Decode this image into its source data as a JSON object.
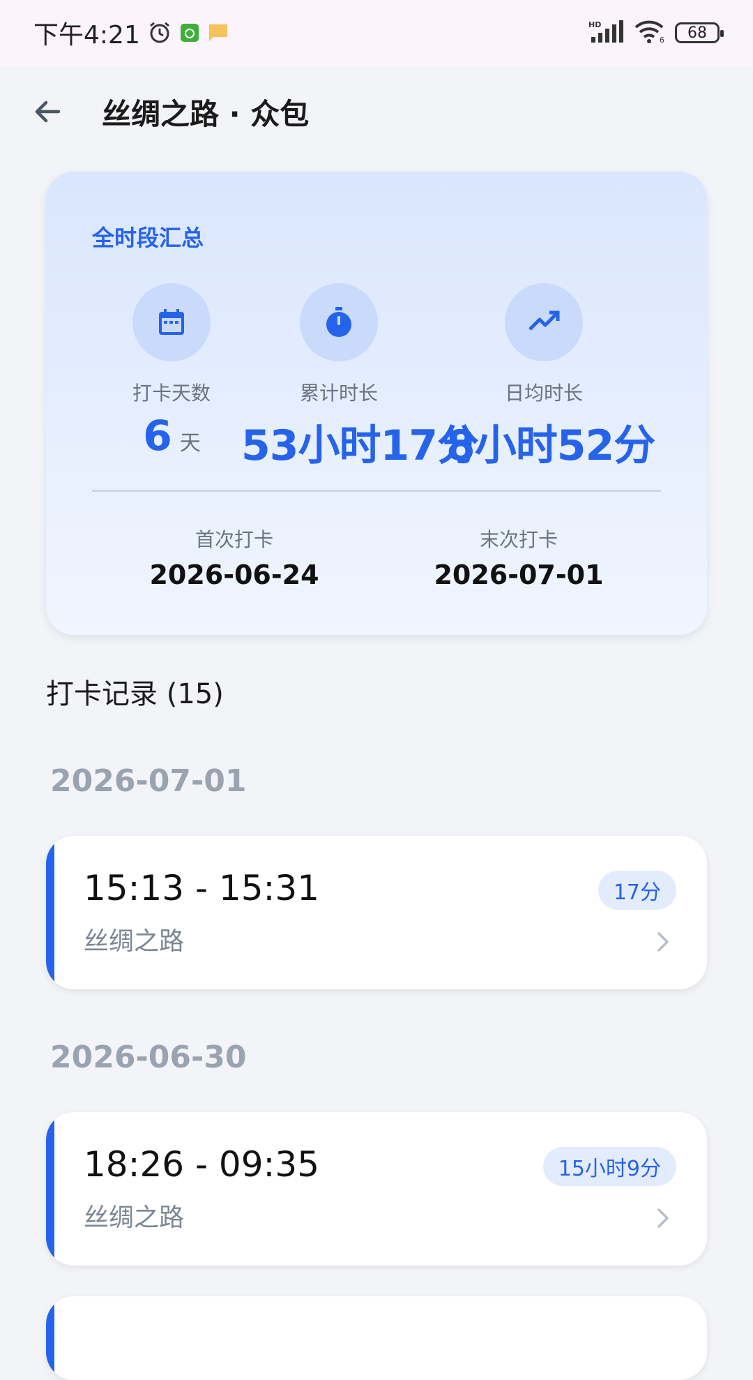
{
  "status_bar": {
    "time": "下午4:21",
    "battery": "68"
  },
  "app_bar": {
    "title": "丝绸之路 · 众包"
  },
  "summary": {
    "title": "全时段汇总",
    "stats": [
      {
        "label": "打卡天数",
        "value": "6",
        "unit": "天",
        "icon": "calendar-icon"
      },
      {
        "label": "累计时长",
        "value": "53小时17分",
        "unit": "",
        "icon": "stopwatch-icon"
      },
      {
        "label": "日均时长",
        "value": "8小时52分",
        "unit": "",
        "icon": "trending-up-icon"
      }
    ],
    "first_label": "首次打卡",
    "first_value": "2026-06-24",
    "last_label": "末次打卡",
    "last_value": "2026-07-01"
  },
  "records_heading": "打卡记录 (15)",
  "groups": [
    {
      "date": "2026-07-01",
      "records": [
        {
          "time": "15:13 - 15:31",
          "place": "丝绸之路",
          "duration": "17分"
        }
      ]
    },
    {
      "date": "2026-06-30",
      "records": [
        {
          "time": "18:26 - 09:35",
          "place": "丝绸之路",
          "duration": "15小时9分"
        }
      ]
    }
  ],
  "colors": {
    "accent": "#2563eb",
    "muted": "#9aa3b0"
  }
}
